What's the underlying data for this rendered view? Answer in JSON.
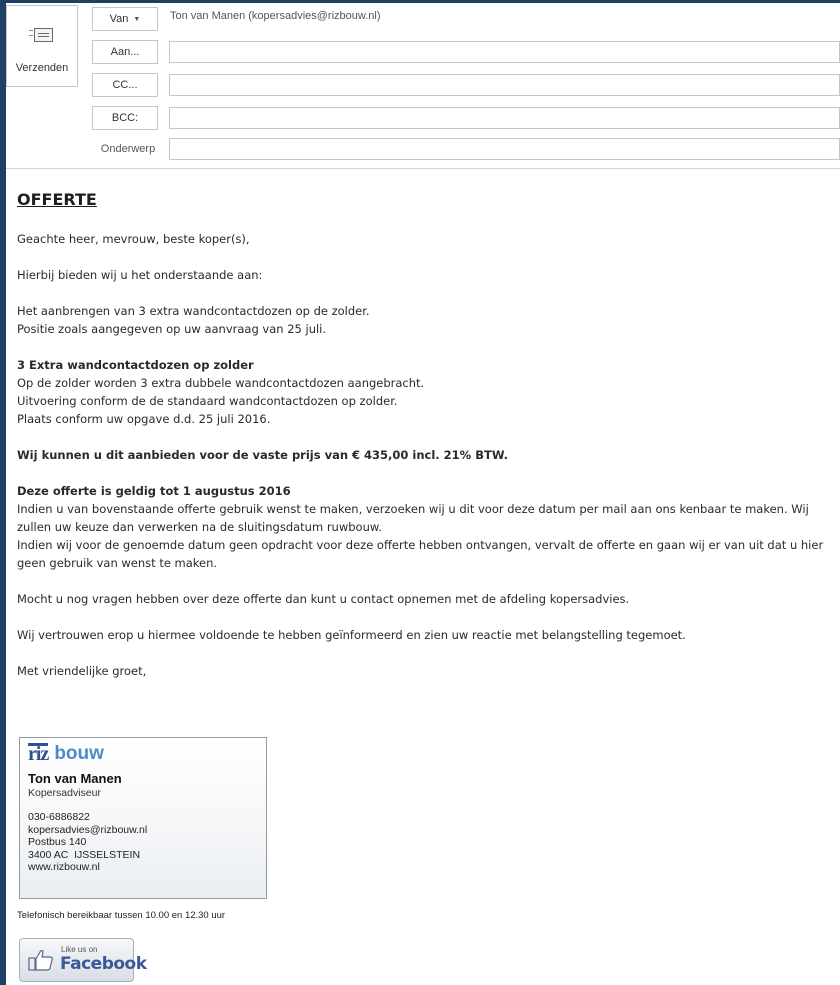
{
  "compose": {
    "send_label": "Verzenden",
    "from_label": "Van",
    "from_value": "Ton van Manen (kopersadvies@rizbouw.nl)",
    "to_label": "Aan...",
    "to_value": "",
    "cc_label": "CC...",
    "cc_value": "",
    "bcc_label": "BCC:",
    "bcc_value": "",
    "subject_label": "Onderwerp",
    "subject_value": ""
  },
  "body": {
    "title": "OFFERTE",
    "greeting": "Geachte heer, mevrouw, beste koper(s),",
    "intro": "Hierbij bieden wij u het onderstaande aan:",
    "line1": "Het aanbrengen van 3 extra wandcontactdozen op de zolder.",
    "line2": "Positie zoals aangegeven op uw aanvraag van 25 juli.",
    "section_heading": "3 Extra wandcontactdozen op zolder",
    "section_line1": "Op de zolder worden 3 extra dubbele wandcontactdozen aangebracht.",
    "section_line2": "Uitvoering conform de de standaard wandcontactdozen op zolder.",
    "section_line3": "Plaats conform uw opgave d.d. 25 juli 2016.",
    "price_line": "Wij kunnen u dit aanbieden voor de vaste prijs van € 435,00 incl. 21% BTW.",
    "validity_heading": "Deze offerte is geldig tot 1 augustus 2016",
    "validity_line1": "Indien u van bovenstaande offerte gebruik wenst te maken, verzoeken wij u dit voor deze datum per mail aan ons kenbaar te maken. Wij",
    "validity_line2": "zullen uw keuze dan verwerken na de sluitingsdatum ruwbouw.",
    "validity_line3": "Indien wij voor de genoemde datum geen opdracht voor deze offerte hebben ontvangen, vervalt de offerte en gaan wij er van uit dat u hier",
    "validity_line4": "geen gebruik van wenst te maken.",
    "questions": "Mocht u nog vragen hebben over deze offerte dan kunt u contact opnemen met de afdeling kopersadvies.",
    "trust": "Wij vertrouwen erop u hiermee voldoende te hebben geïnformeerd en zien uw reactie met belangstelling tegemoet.",
    "closing": "Met vriendelijke groet,"
  },
  "signature": {
    "logo_riz": "riz",
    "logo_bouw": "bouw",
    "name": "Ton van Manen",
    "role": "Kopersadviseur",
    "phone": "030-6886822",
    "email": "kopersadvies@rizbouw.nl",
    "postbus": "Postbus 140",
    "city": "3400 AC  IJSSELSTEIN",
    "website": "www.rizbouw.nl"
  },
  "phone_note": "Telefonisch bereikbaar tussen 10.00 en 12.30 uur",
  "facebook": {
    "like_label": "Like us on",
    "brand": "Facebook"
  },
  "colors": {
    "frame": "#1e3f66",
    "logo_dark": "#2e5190",
    "logo_light": "#4b8bc9",
    "facebook": "#3b5998"
  }
}
